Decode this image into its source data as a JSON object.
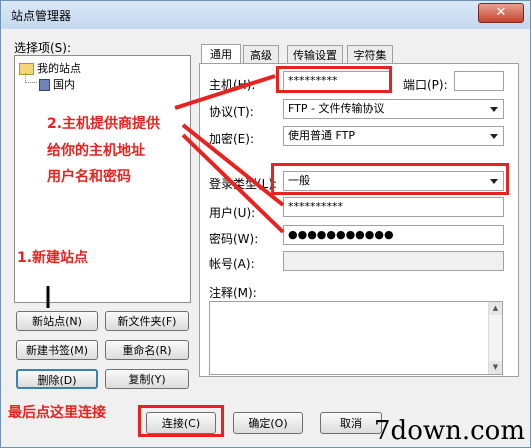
{
  "window": {
    "title": "站点管理器",
    "close": "✕"
  },
  "left": {
    "select_label": "选择项(S):",
    "tree": {
      "root": "我的站点",
      "child": "国内"
    },
    "buttons": {
      "new_site": "新站点(N)",
      "new_folder": "新文件夹(F)",
      "new_bookmark": "新建书签(M)",
      "rename": "重命名(R)",
      "delete": "删除(D)",
      "copy": "复制(Y)"
    }
  },
  "tabs": [
    "通用",
    "高级",
    "传输设置",
    "字符集"
  ],
  "form": {
    "host_label": "主机(H):",
    "host_value": "*********",
    "port_label": "端口(P):",
    "port_value": "",
    "protocol_label": "协议(T):",
    "protocol_value": "FTP - 文件传输协议",
    "encrypt_label": "加密(E):",
    "encrypt_value": "使用普通 FTP",
    "logon_label": "登录类型(L):",
    "logon_value": "一般",
    "user_label": "用户(U):",
    "user_value": "**********",
    "password_label": "密码(W):",
    "password_value": "●●●●●●●●●●●",
    "account_label": "帐号(A):",
    "account_value": "",
    "comment_label": "注释(M):"
  },
  "bottom": {
    "connect": "连接(C)",
    "ok": "确定(O)",
    "cancel": "取消"
  },
  "annotations": {
    "a1": "1.新建站点",
    "a2_line1": "2.主机提供商提供",
    "a2_line2": "给你的主机地址",
    "a2_line3": "用户名和密码",
    "a3": "最后点这里连接"
  },
  "watermark": "7down.com",
  "colors": {
    "annotation_red": "#e8231f"
  }
}
